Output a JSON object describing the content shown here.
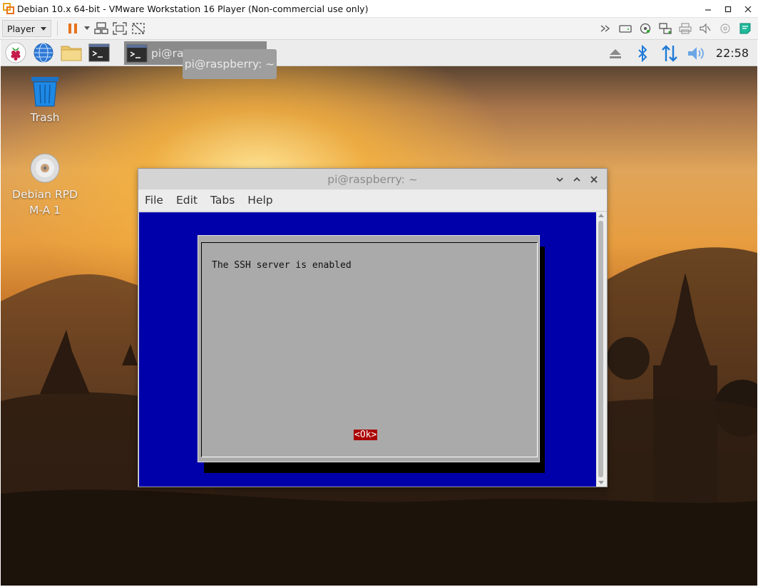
{
  "host": {
    "title": "Debian 10.x 64-bit - VMware Workstation 16 Player (Non-commercial use only)",
    "player_menu": "Player"
  },
  "guest": {
    "panel": {
      "task_label": "pi@rasp",
      "clock": "22:58"
    },
    "tooltip": "pi@raspberry: ~",
    "desktop_icons": [
      {
        "label": "Trash"
      },
      {
        "label_line1": "Debian RPD",
        "label_line2": "M-A 1"
      }
    ],
    "terminal": {
      "title": "pi@raspberry: ~",
      "menu": [
        "File",
        "Edit",
        "Tabs",
        "Help"
      ],
      "dialog": {
        "message": "The SSH server is enabled",
        "ok_label": "<Ok>"
      }
    }
  },
  "colors": {
    "terminal_bg": "#0000aa",
    "dialog_bg": "#aaaaaa",
    "ok_button_bg": "#aa0000",
    "vmware_accent": "#e8731c",
    "bluetooth_blue": "#1f7ad8"
  }
}
